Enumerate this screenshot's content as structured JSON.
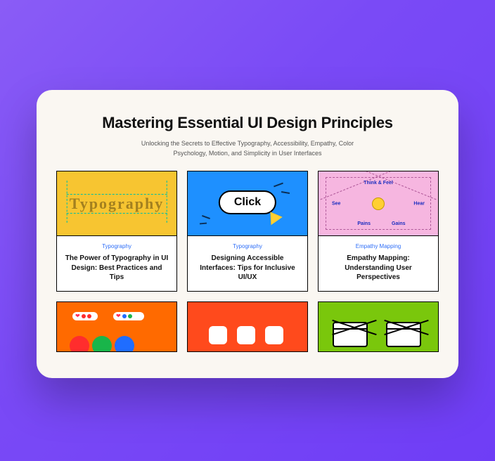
{
  "header": {
    "title": "Mastering Essential UI Design Principles",
    "subtitle": "Unlocking the Secrets to Effective Typography, Accessibility, Empathy, Color Psychology, Motion, and Simplicity in User Interfaces"
  },
  "cards": [
    {
      "category": "Typography",
      "title": "The Power of Typography in UI Design: Best Practices and Tips",
      "thumb_word": "Typography",
      "colors": {
        "bg": "#f7c531"
      }
    },
    {
      "category": "Typography",
      "title": "Designing Accessible Interfaces: Tips for Inclusive UI/UX",
      "button_label": "Click",
      "colors": {
        "bg": "#1e90ff"
      }
    },
    {
      "category": "Empathy Mapping",
      "title": "Empathy Mapping: Understanding User Perspectives",
      "labels": {
        "think": "Think & Feel",
        "see": "See",
        "hear": "Hear",
        "pains": "Pains",
        "gains": "Gains"
      },
      "colors": {
        "bg": "#f6b6e0"
      }
    },
    {
      "category": "",
      "title": "",
      "colors": {
        "bg": "#ff6a00"
      }
    },
    {
      "category": "",
      "title": "",
      "colors": {
        "bg": "#ff4a1c"
      }
    },
    {
      "category": "",
      "title": "",
      "colors": {
        "bg": "#7ac70c"
      }
    }
  ]
}
